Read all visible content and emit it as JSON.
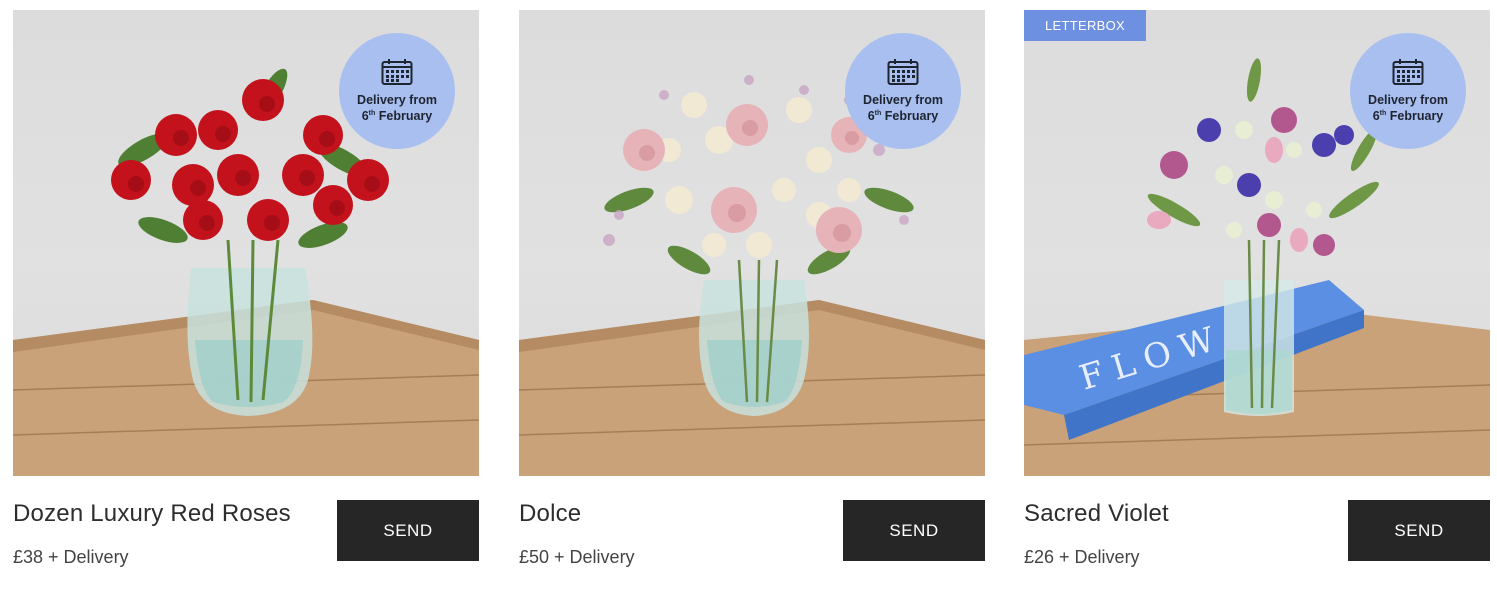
{
  "products": [
    {
      "name": "Dozen Luxury Red Roses",
      "price": "£38 + Delivery",
      "button": "SEND",
      "badge": {
        "line1": "Delivery from",
        "day": "6",
        "ordinal": "th",
        "month": "February",
        "icon": "calendar-icon"
      },
      "tag": ""
    },
    {
      "name": "Dolce",
      "price": "£50 + Delivery",
      "button": "SEND",
      "badge": {
        "line1": "Delivery from",
        "day": "6",
        "ordinal": "th",
        "month": "February",
        "icon": "calendar-icon"
      },
      "tag": ""
    },
    {
      "name": "Sacred Violet",
      "price": "£26 + Delivery",
      "button": "SEND",
      "badge": {
        "line1": "Delivery from",
        "day": "6",
        "ordinal": "th",
        "month": "February",
        "icon": "calendar-icon"
      },
      "tag": "LETTERBOX"
    }
  ],
  "colors": {
    "badge": "#a8bff0",
    "tag": "#6e90e0",
    "button": "#262626",
    "table": "#c9a27a"
  }
}
